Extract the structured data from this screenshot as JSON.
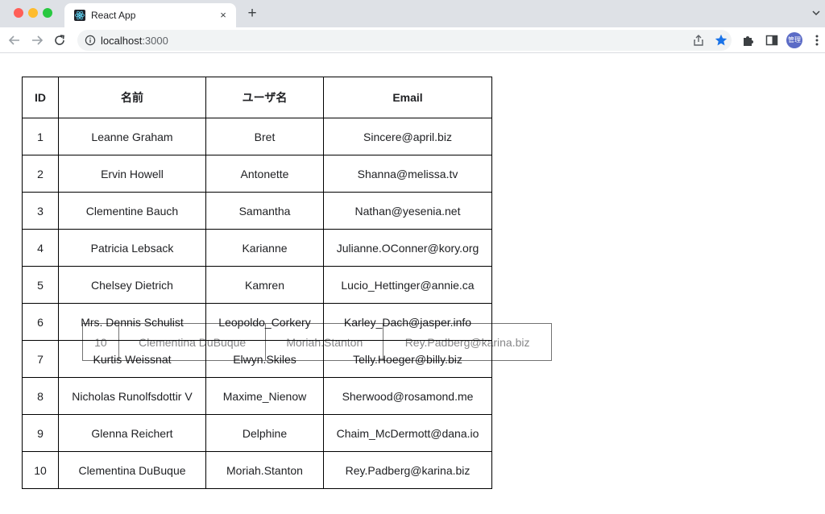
{
  "browser": {
    "tab": {
      "title": "React App",
      "favicon": "react-icon",
      "close": "×"
    },
    "new_tab": "+",
    "url": {
      "host": "localhost",
      "port": ":3000"
    },
    "profile": {
      "avatar_text": "管理"
    },
    "colors": {
      "star": "#1a73e8",
      "tabbar": "#dee1e6"
    }
  },
  "table": {
    "headers": {
      "id": "ID",
      "name": "名前",
      "username": "ユーザ名",
      "email": "Email"
    },
    "rows": [
      {
        "id": "1",
        "name": "Leanne Graham",
        "username": "Bret",
        "email": "Sincere@april.biz"
      },
      {
        "id": "2",
        "name": "Ervin Howell",
        "username": "Antonette",
        "email": "Shanna@melissa.tv"
      },
      {
        "id": "3",
        "name": "Clementine Bauch",
        "username": "Samantha",
        "email": "Nathan@yesenia.net"
      },
      {
        "id": "4",
        "name": "Patricia Lebsack",
        "username": "Karianne",
        "email": "Julianne.OConner@kory.org"
      },
      {
        "id": "5",
        "name": "Chelsey Dietrich",
        "username": "Kamren",
        "email": "Lucio_Hettinger@annie.ca"
      },
      {
        "id": "6",
        "name": "Mrs. Dennis Schulist",
        "username": "Leopoldo_Corkery",
        "email": "Karley_Dach@jasper.info"
      },
      {
        "id": "7",
        "name": "Kurtis Weissnat",
        "username": "Elwyn.Skiles",
        "email": "Telly.Hoeger@billy.biz"
      },
      {
        "id": "8",
        "name": "Nicholas Runolfsdottir V",
        "username": "Maxime_Nienow",
        "email": "Sherwood@rosamond.me"
      },
      {
        "id": "9",
        "name": "Glenna Reichert",
        "username": "Delphine",
        "email": "Chaim_McDermott@dana.io"
      },
      {
        "id": "10",
        "name": "Clementina DuBuque",
        "username": "Moriah.Stanton",
        "email": "Rey.Padberg@karina.biz"
      }
    ]
  },
  "drag_ghost": {
    "id": "10",
    "name": "Clementina DuBuque",
    "username": "Moriah.Stanton",
    "email": "Rey.Padberg@karina.biz"
  }
}
